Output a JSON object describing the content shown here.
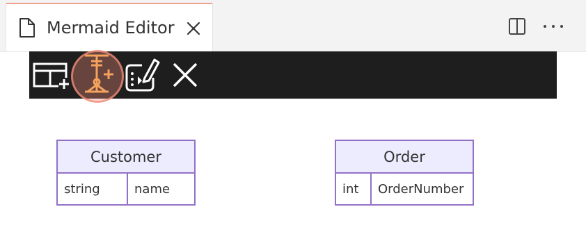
{
  "tab": {
    "title": "Mermaid Editor",
    "close_icon": "close-icon",
    "file_icon": "file-icon"
  },
  "editor_actions": {
    "split_icon": "split-editor-icon",
    "more_icon": "more-actions-icon"
  },
  "toolbar": {
    "buttons": [
      {
        "icon": "add-entity-icon",
        "color": "#ffffff"
      },
      {
        "icon": "add-relationship-icon",
        "color": "#f5a25d",
        "active": true
      },
      {
        "icon": "edit-code-icon",
        "color": "#ffffff"
      },
      {
        "icon": "close-icon",
        "color": "#ffffff"
      }
    ],
    "background": "#1e1e1e",
    "highlight_color": "#f08c78"
  },
  "diagram": {
    "border_color": "#9370c8",
    "header_color": "#ececfe",
    "entities": [
      {
        "name": "Customer",
        "attributes": [
          {
            "type": "string",
            "name": "name"
          }
        ]
      },
      {
        "name": "Order",
        "attributes": [
          {
            "type": "int",
            "name": "OrderNumber"
          }
        ]
      }
    ]
  }
}
